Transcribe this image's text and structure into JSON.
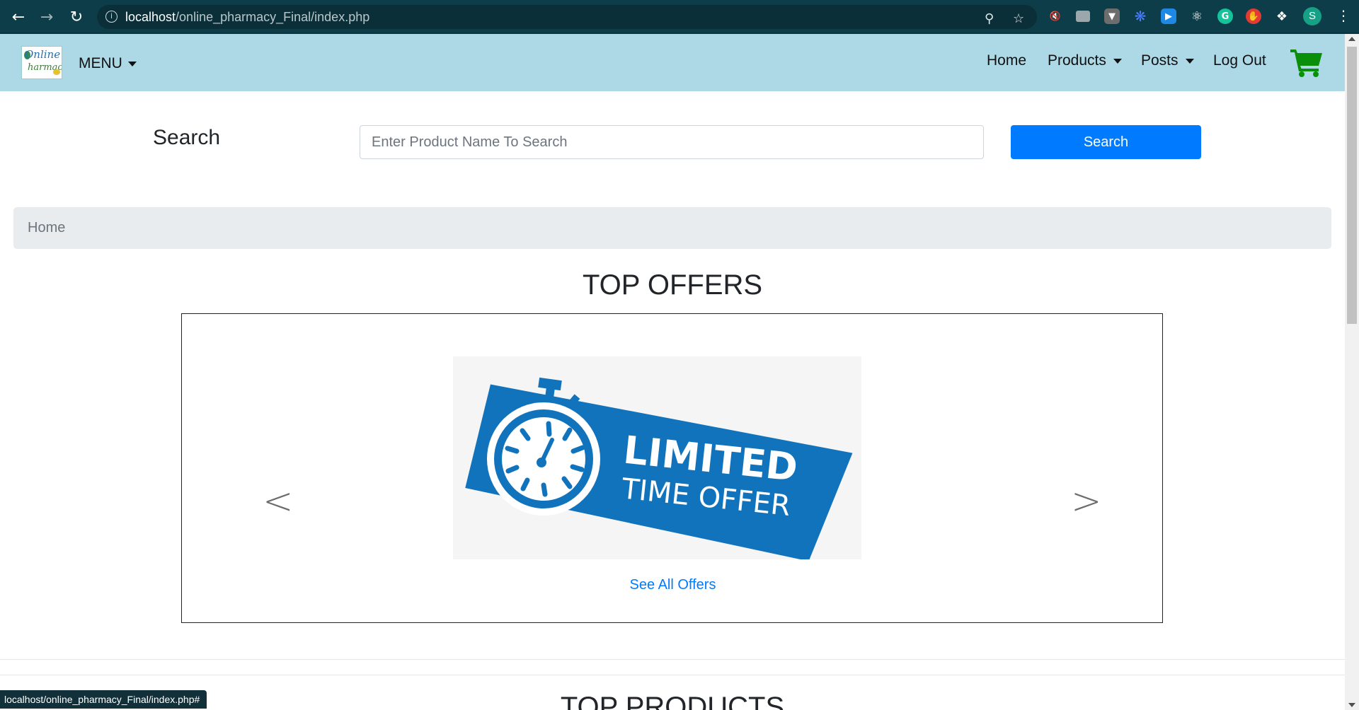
{
  "browser": {
    "url_host": "localhost",
    "url_path": "/online_pharmacy_Final/index.php",
    "status_url": "localhost/online_pharmacy_Final/index.php#",
    "profile_initial": "S"
  },
  "navbar": {
    "logo_text_1": "Online",
    "logo_text_2": "harmacy",
    "menu_label": "MENU",
    "links": {
      "home": "Home",
      "products": "Products",
      "posts": "Posts",
      "logout": "Log Out"
    },
    "background": "#add8e6",
    "cart_color": "#0a8f0a"
  },
  "search": {
    "label": "Search",
    "placeholder": "Enter Product Name To Search",
    "value": "",
    "button_label": "Search",
    "button_color": "#007bff"
  },
  "breadcrumb": {
    "current": "Home"
  },
  "offers": {
    "title": "TOP OFFERS",
    "prev": "<",
    "next": ">",
    "banner_line_1": "LIMITED",
    "banner_line_2": "TIME OFFER",
    "banner_color": "#1273bd",
    "see_all": "See All Offers"
  },
  "products": {
    "title": "TOP PRODUCTS"
  }
}
